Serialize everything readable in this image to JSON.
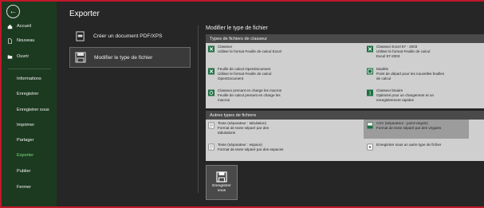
{
  "sidebar": {
    "back_icon": "arrow-left-icon",
    "top_items": [
      {
        "label": "Accueil",
        "icon": "home-icon"
      },
      {
        "label": "Nouveau",
        "icon": "new-document-icon"
      },
      {
        "label": "Ouvrir",
        "icon": "open-folder-icon"
      }
    ],
    "items": [
      {
        "label": "Informations"
      },
      {
        "label": "Enregistrer"
      },
      {
        "label": "Enregistrer sous"
      },
      {
        "label": "Imprimer"
      },
      {
        "label": "Partager"
      },
      {
        "label": "Exporter",
        "active": true
      },
      {
        "label": "Publier"
      },
      {
        "label": "Fermer"
      }
    ]
  },
  "main": {
    "title": "Exporter",
    "options": [
      {
        "label": "Créer un document PDF/XPS",
        "icon": "pdf-document-icon"
      },
      {
        "label": "Modifier le type de fichier",
        "icon": "change-file-type-icon",
        "selected": true
      }
    ]
  },
  "file_type": {
    "title": "Modifier le type de fichier",
    "workbook_section": {
      "header": "Types de fichiers de classeur",
      "items": [
        {
          "title": "Classeur",
          "desc1": "Utiliser le format Feuille de calcul Excel",
          "desc2": ""
        },
        {
          "title": "Classeur Excel 97 - 2003",
          "desc1": "Utiliser le format Feuille de calcul",
          "desc2": "Excel 97-2003"
        },
        {
          "title": "Feuille de calcul OpenDocument",
          "desc1": "Utiliser le format Feuille de calcul",
          "desc2": "OpenDocument"
        },
        {
          "title": "Modèle",
          "desc1": "Point de départ pour les nouvelles feuilles",
          "desc2": "de calcul"
        },
        {
          "title": "Classeur prenant en charge les macros",
          "desc1": "Feuille de calcul prenant en charge les",
          "desc2": "macros"
        },
        {
          "title": "Classeur binaire",
          "desc1": "Optimisé pour un chargement et un",
          "desc2": "enregistrement rapides"
        }
      ]
    },
    "other_section": {
      "header": "Autres types de fichiers",
      "items": [
        {
          "title": "Texte (séparateur : tabulation)",
          "desc1": "Format de texte séparé par des",
          "desc2": "tabulations"
        },
        {
          "title": "CSV (séparateur : point-virgule)",
          "desc1": "Format de texte séparé par des virgules",
          "desc2": "",
          "highlighted": true
        },
        {
          "title": "Texte (séparateur : espace)",
          "desc1": "Format de texte séparé par des espaces",
          "desc2": ""
        },
        {
          "title": "Enregistrer sous un autre type de fichier",
          "desc1": "",
          "desc2": ""
        }
      ]
    },
    "save_button": {
      "line1": "Enregistrer",
      "line2": "sous",
      "icon": "floppy-disk-icon"
    }
  }
}
